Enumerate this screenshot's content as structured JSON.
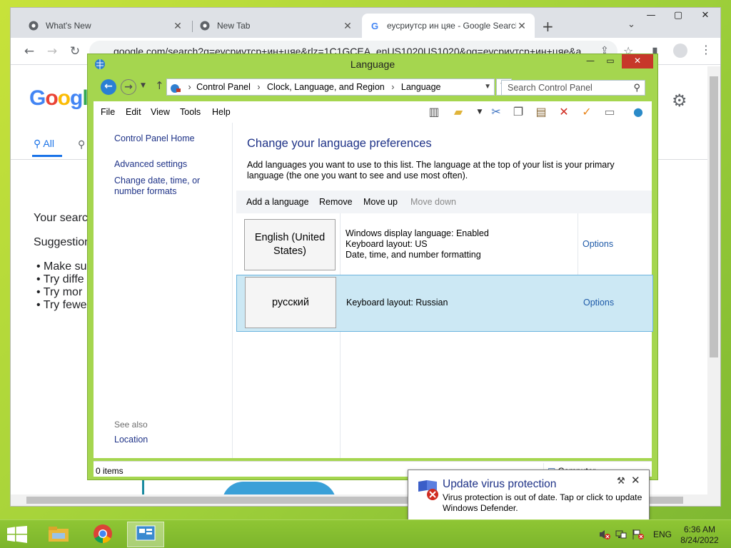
{
  "browser": {
    "tabs": [
      {
        "title": "What's New",
        "active": false
      },
      {
        "title": "New Tab",
        "active": false
      },
      {
        "title": "еусриутср ин цяе - Google Search",
        "active": true
      }
    ],
    "url": "google.com/search?q=еусриутср+ин+цяе&rlz=1C1GCEA_enUS1020US1020&oq=еусриутср+ин+цяе&a",
    "page": {
      "logo_text": "Google",
      "tab_all": "All",
      "your_search": "Your search",
      "suggestions": "Suggestions",
      "bullets": [
        "Make su",
        "Try diffe",
        "Try mor",
        "Try fewe"
      ]
    }
  },
  "control_panel": {
    "title": "Language",
    "breadcrumb": [
      "Control Panel",
      "Clock, Language, and Region",
      "Language"
    ],
    "search_placeholder": "Search Control Panel",
    "menu": [
      "File",
      "Edit",
      "View",
      "Tools",
      "Help"
    ],
    "sidebar": {
      "home": "Control Panel Home",
      "links": [
        "Advanced settings",
        "Change date, time, or number formats"
      ],
      "see_also_label": "See also",
      "see_also_links": [
        "Location"
      ]
    },
    "heading": "Change your language preferences",
    "description": "Add languages you want to use to this list. The language at the top of your list is your primary language (the one you want to see and use most often).",
    "commands": {
      "add": "Add a language",
      "remove": "Remove",
      "move_up": "Move up",
      "move_down": "Move down"
    },
    "languages": [
      {
        "name": "English (United States)",
        "details": [
          "Windows display language: Enabled",
          "Keyboard layout: US",
          "Date, time, and number formatting"
        ],
        "options": "Options",
        "selected": false
      },
      {
        "name": "русский",
        "details": [
          "Keyboard layout: Russian"
        ],
        "options": "Options",
        "selected": true
      }
    ],
    "status": {
      "items": "0 items",
      "location": "Computer"
    }
  },
  "notification": {
    "title": "Update virus protection",
    "body": "Virus protection is out of date. Tap or click to update Windows Defender."
  },
  "taskbar": {
    "apps": [
      "file-explorer",
      "google-chrome",
      "control-panel"
    ],
    "language": "ENG",
    "time": "6:36 AM",
    "date": "8/24/2022"
  },
  "colors": {
    "desktop_green": "#9fd03a",
    "window_frame": "#a5d64f",
    "close_red": "#c7372a",
    "link_blue": "#1e3287",
    "selection": "#cce8f4"
  }
}
